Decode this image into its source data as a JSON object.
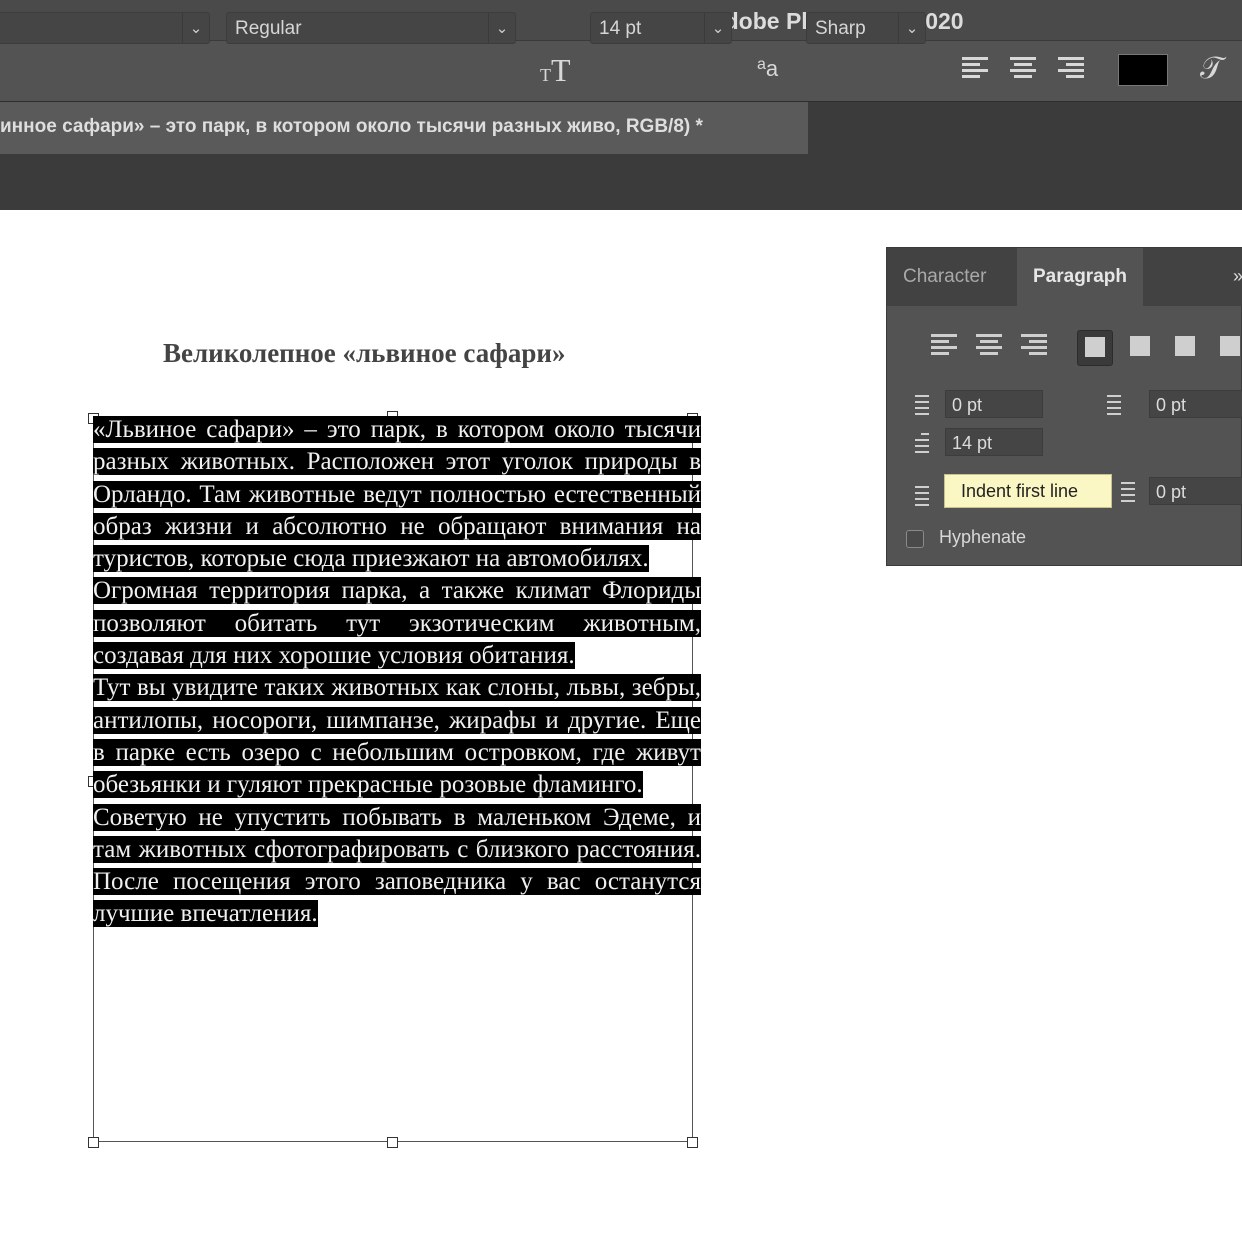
{
  "app": {
    "title": "Adobe Photoshop 2020"
  },
  "options_bar": {
    "font_style": "Regular",
    "font_size": "14 pt",
    "antialias": "Sharp",
    "text_color": "#000000",
    "icons": [
      "chevron-down-icon",
      "font-size-icon",
      "antialias-icon",
      "align-left-icon",
      "align-center-icon",
      "align-right-icon",
      "warp-text-icon"
    ]
  },
  "document": {
    "tab_title": "инное сафари» – это парк, в котором около тысячи разных живо, RGB/8) *",
    "heading": "Великолепное «львиное сафари»",
    "paragraphs": [
      "«Львиное сафари» – это парк, в котором около тысячи разных животных. Расположен этот уголок природы в Орландо. Там животные ведут полностью естественный образ жизни и абсолютно не обращают внимания на туристов, которые сюда приезжают на автомобилях.",
      "Огромная территория парка, а также климат Флориды позволяют обитать тут экзотическим животным, создавая для них хорошие условия обитания.",
      "Тут вы увидите таких животных как слоны, львы, зебры, антилопы, носороги, шимпанзе, жирафы и другие. Еще в парке есть озеро с небольшим островком, где живут обезьянки и гуляют прекрасные розовые фламинго.",
      "Советую не упустить побывать в маленьком Эдеме, и там животных сфотографировать с близкого расстояния. После посещения этого заповедника у вас останутся лучшие впечатления."
    ]
  },
  "panel": {
    "tabs": [
      "Character",
      "Paragraph"
    ],
    "active_tab": "Paragraph",
    "indent_left": "0 pt",
    "indent_right": "0 pt",
    "indent_first_line": "14 pt",
    "space_after": "0 pt",
    "tooltip": "Indent first line",
    "hyphenate_label": "Hyphenate",
    "hyphenate_checked": false
  }
}
